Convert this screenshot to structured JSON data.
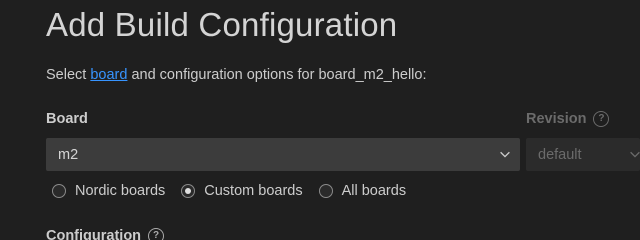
{
  "page": {
    "title": "Add Build Configuration",
    "subtitle_prefix": "Select ",
    "subtitle_link": "board",
    "subtitle_suffix": " and configuration options for board_m2_hello:"
  },
  "board": {
    "label": "Board",
    "selected": "m2",
    "filters": [
      {
        "label": "Nordic boards",
        "checked": false
      },
      {
        "label": "Custom boards",
        "checked": true
      },
      {
        "label": "All boards",
        "checked": false
      }
    ]
  },
  "revision": {
    "label": "Revision",
    "selected": "default",
    "disabled": true
  },
  "configuration": {
    "label": "Configuration"
  },
  "icons": {
    "help": "question-circle-icon",
    "dropdown": "chevron-down-icon"
  },
  "colors": {
    "background": "#1f1f1f",
    "link": "#3794ff",
    "input_background": "#3c3c3c",
    "disabled_text": "#6b6b6b"
  }
}
